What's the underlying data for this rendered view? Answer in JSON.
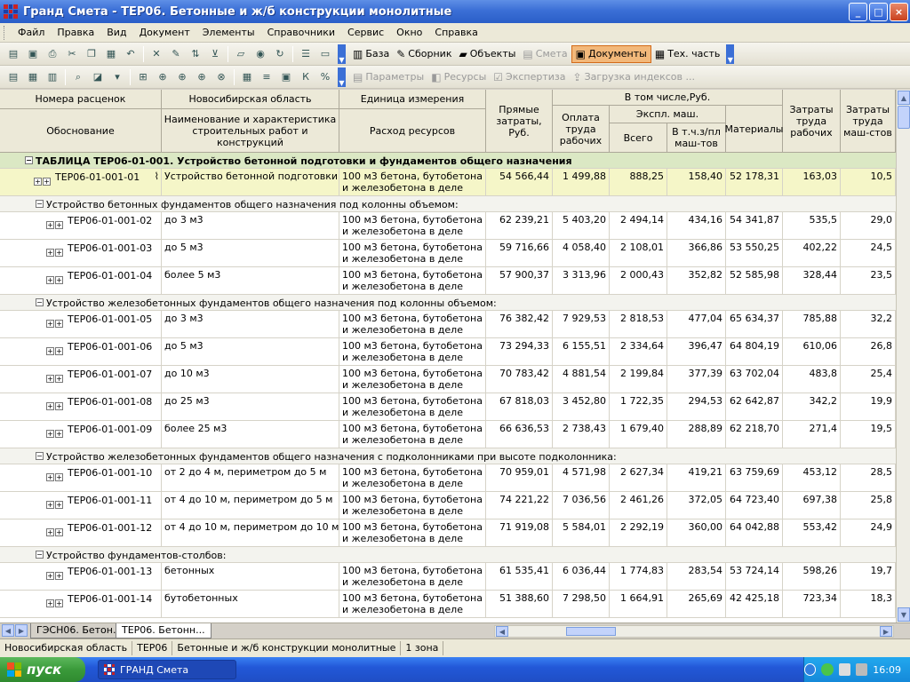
{
  "window": {
    "title": "Гранд Смета - ТЕР06. Бетонные и ж/б конструкции монолитные",
    "buttons": {
      "minimize": "_",
      "maximize": "□",
      "close": "×"
    }
  },
  "menu": [
    "Файл",
    "Правка",
    "Вид",
    "Документ",
    "Элементы",
    "Справочники",
    "Сервис",
    "Окно",
    "Справка"
  ],
  "toolbar1": {
    "labels": [
      {
        "text": "База",
        "icon": "books-icon",
        "state": "normal"
      },
      {
        "text": "Сборник",
        "icon": "pencil-icon",
        "state": "normal"
      },
      {
        "text": "Объекты",
        "icon": "folder-icon",
        "state": "normal"
      },
      {
        "text": "Смета",
        "icon": "estimate-icon",
        "state": "disabled"
      },
      {
        "text": "Документы",
        "icon": "document-icon",
        "state": "active"
      },
      {
        "text": "Тех. часть",
        "icon": "tech-icon",
        "state": "normal"
      }
    ]
  },
  "toolbar2": {
    "labels": [
      {
        "text": "Параметры",
        "icon": "params-icon",
        "state": "disabled"
      },
      {
        "text": "Ресурсы",
        "icon": "resources-icon",
        "state": "disabled"
      },
      {
        "text": "Экспертиза",
        "icon": "check-icon",
        "state": "disabled"
      },
      {
        "text": "Загрузка индексов ...",
        "icon": "index-icon",
        "state": "disabled"
      }
    ]
  },
  "colors": {
    "accent": "#f2b87a",
    "group_row": "#dbe8c4",
    "selected_row": "#f5f6c8",
    "titlebar": "#3b6fd6"
  },
  "grid": {
    "headers": {
      "code_top": "Номера расценок",
      "code_bottom": "Обоснование",
      "region": "Новосибирская область",
      "name": "Наименование и характеристика строительных работ и конструкций",
      "unit_top": "Единица измерения",
      "unit_bottom": "Расход ресурсов",
      "direct": "Прямые затраты, Руб.",
      "incl": "В том числе,Руб.",
      "wages": "Оплата труда рабочих",
      "machines": "Экспл. маш.",
      "machines_total": "Всего",
      "machines_wages": "В т.ч.з/пл маш-тов",
      "materials": "Материалы",
      "labor_workers": "Затраты труда рабочих",
      "labor_machinists": "Затраты труда маш-стов"
    },
    "rows": [
      {
        "kind": "group",
        "text": "ТАБЛИЦА ТЕР06-01-001. Устройство бетонной подготовки и фундаментов общего назначения"
      },
      {
        "kind": "item",
        "selected": true,
        "level": 1,
        "code": "ТЕР06-01-001-01",
        "name": "Устройство бетонной подготовки",
        "unit": "100 м3 бетона, бутобетона и железобетона в деле",
        "direct": "54 566,44",
        "wages": "1 499,88",
        "mach": "888,25",
        "mach_w": "158,40",
        "mat": "52 178,31",
        "lw": "163,03",
        "lm": "10,5"
      },
      {
        "kind": "sub",
        "text": "Устройство бетонных фундаментов общего назначения под колонны объемом:"
      },
      {
        "kind": "item",
        "level": 2,
        "code": "ТЕР06-01-001-02",
        "name": "до 3 м3",
        "unit": "100 м3 бетона, бутобетона и железобетона в деле",
        "direct": "62 239,21",
        "wages": "5 403,20",
        "mach": "2 494,14",
        "mach_w": "434,16",
        "mat": "54 341,87",
        "lw": "535,5",
        "lm": "29,0"
      },
      {
        "kind": "item",
        "level": 2,
        "code": "ТЕР06-01-001-03",
        "name": "до 5 м3",
        "unit": "100 м3 бетона, бутобетона и железобетона в деле",
        "direct": "59 716,66",
        "wages": "4 058,40",
        "mach": "2 108,01",
        "mach_w": "366,86",
        "mat": "53 550,25",
        "lw": "402,22",
        "lm": "24,5"
      },
      {
        "kind": "item",
        "level": 2,
        "code": "ТЕР06-01-001-04",
        "name": "более 5 м3",
        "unit": "100 м3 бетона, бутобетона и железобетона в деле",
        "direct": "57 900,37",
        "wages": "3 313,96",
        "mach": "2 000,43",
        "mach_w": "352,82",
        "mat": "52 585,98",
        "lw": "328,44",
        "lm": "23,5"
      },
      {
        "kind": "sub",
        "text": "Устройство железобетонных фундаментов общего назначения под колонны объемом:"
      },
      {
        "kind": "item",
        "level": 2,
        "code": "ТЕР06-01-001-05",
        "name": "до 3 м3",
        "unit": "100 м3 бетона, бутобетона и железобетона в деле",
        "direct": "76 382,42",
        "wages": "7 929,53",
        "mach": "2 818,53",
        "mach_w": "477,04",
        "mat": "65 634,37",
        "lw": "785,88",
        "lm": "32,2"
      },
      {
        "kind": "item",
        "level": 2,
        "code": "ТЕР06-01-001-06",
        "name": "до 5 м3",
        "unit": "100 м3 бетона, бутобетона и железобетона в деле",
        "direct": "73 294,33",
        "wages": "6 155,51",
        "mach": "2 334,64",
        "mach_w": "396,47",
        "mat": "64 804,19",
        "lw": "610,06",
        "lm": "26,8"
      },
      {
        "kind": "item",
        "level": 2,
        "code": "ТЕР06-01-001-07",
        "name": "до 10 м3",
        "unit": "100 м3 бетона, бутобетона и железобетона в деле",
        "direct": "70 783,42",
        "wages": "4 881,54",
        "mach": "2 199,84",
        "mach_w": "377,39",
        "mat": "63 702,04",
        "lw": "483,8",
        "lm": "25,4"
      },
      {
        "kind": "item",
        "level": 2,
        "code": "ТЕР06-01-001-08",
        "name": "до 25 м3",
        "unit": "100 м3 бетона, бутобетона и железобетона в деле",
        "direct": "67 818,03",
        "wages": "3 452,80",
        "mach": "1 722,35",
        "mach_w": "294,53",
        "mat": "62 642,87",
        "lw": "342,2",
        "lm": "19,9"
      },
      {
        "kind": "item",
        "level": 2,
        "code": "ТЕР06-01-001-09",
        "name": "более 25 м3",
        "unit": "100 м3 бетона, бутобетона и железобетона в деле",
        "direct": "66 636,53",
        "wages": "2 738,43",
        "mach": "1 679,40",
        "mach_w": "288,89",
        "mat": "62 218,70",
        "lw": "271,4",
        "lm": "19,5"
      },
      {
        "kind": "sub",
        "text": "Устройство железобетонных фундаментов общего назначения с подколонниками при высоте подколонника:"
      },
      {
        "kind": "item",
        "level": 2,
        "code": "ТЕР06-01-001-10",
        "name": "от 2 до 4 м, периметром до 5 м",
        "unit": "100 м3 бетона, бутобетона и железобетона в деле",
        "direct": "70 959,01",
        "wages": "4 571,98",
        "mach": "2 627,34",
        "mach_w": "419,21",
        "mat": "63 759,69",
        "lw": "453,12",
        "lm": "28,5"
      },
      {
        "kind": "item",
        "level": 2,
        "code": "ТЕР06-01-001-11",
        "name": "от 4 до 10 м, периметром до 5 м",
        "unit": "100 м3 бетона, бутобетона и железобетона в деле",
        "direct": "74 221,22",
        "wages": "7 036,56",
        "mach": "2 461,26",
        "mach_w": "372,05",
        "mat": "64 723,40",
        "lw": "697,38",
        "lm": "25,8"
      },
      {
        "kind": "item",
        "level": 2,
        "code": "ТЕР06-01-001-12",
        "name": "от 4 до 10 м, периметром до 10 м",
        "unit": "100 м3 бетона, бутобетона и железобетона в деле",
        "direct": "71 919,08",
        "wages": "5 584,01",
        "mach": "2 292,19",
        "mach_w": "360,00",
        "mat": "64 042,88",
        "lw": "553,42",
        "lm": "24,9"
      },
      {
        "kind": "sub",
        "text": "Устройство фундаментов-столбов:"
      },
      {
        "kind": "item",
        "level": 2,
        "code": "ТЕР06-01-001-13",
        "name": "бетонных",
        "unit": "100 м3 бетона, бутобетона и железобетона в деле",
        "direct": "61 535,41",
        "wages": "6 036,44",
        "mach": "1 774,83",
        "mach_w": "283,54",
        "mat": "53 724,14",
        "lw": "598,26",
        "lm": "19,7"
      },
      {
        "kind": "item",
        "level": 2,
        "code": "ТЕР06-01-001-14",
        "name": "бутобетонных",
        "unit": "100 м3 бетона, бутобетона и железобетона в деле",
        "direct": "51 388,60",
        "wages": "7 298,50",
        "mach": "1 664,91",
        "mach_w": "265,69",
        "mat": "42 425,18",
        "lw": "723,34",
        "lm": "18,3"
      }
    ]
  },
  "tabs": [
    {
      "label": "ГЭСН06. Бетон...",
      "active": false
    },
    {
      "label": "ТЕР06. Бетонн...",
      "active": true
    }
  ],
  "status": [
    "Новосибирская область",
    "ТЕР06",
    "Бетонные и ж/б конструкции монолитные",
    "1 зона"
  ],
  "taskbar": {
    "start": "пуск",
    "item": "ГРАНД Смета",
    "clock": "16:09"
  }
}
